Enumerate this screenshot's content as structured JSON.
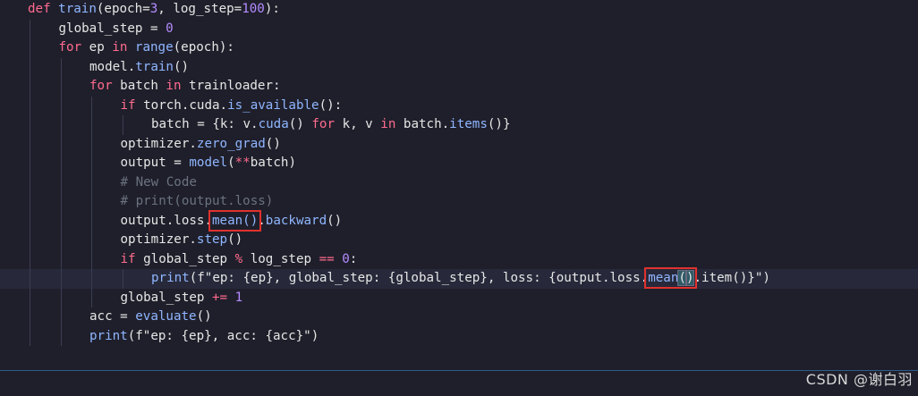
{
  "editor": {
    "lines": [
      [
        {
          "t": "def ",
          "c": "kw"
        },
        {
          "t": "train",
          "c": "fn"
        },
        {
          "t": "(epoch=",
          "c": "tx"
        },
        {
          "t": "3",
          "c": "num"
        },
        {
          "t": ", log_step=",
          "c": "tx"
        },
        {
          "t": "100",
          "c": "num"
        },
        {
          "t": "):",
          "c": "tx"
        }
      ],
      [
        {
          "t": "global_step = ",
          "c": "tx"
        },
        {
          "t": "0",
          "c": "num"
        }
      ],
      [
        {
          "t": "for ",
          "c": "kw"
        },
        {
          "t": "ep ",
          "c": "tx"
        },
        {
          "t": "in ",
          "c": "kw"
        },
        {
          "t": "range",
          "c": "fn"
        },
        {
          "t": "(epoch):",
          "c": "tx"
        }
      ],
      [
        {
          "t": "model.",
          "c": "tx"
        },
        {
          "t": "train",
          "c": "fn"
        },
        {
          "t": "()",
          "c": "tx"
        }
      ],
      [
        {
          "t": "for ",
          "c": "kw"
        },
        {
          "t": "batch ",
          "c": "tx"
        },
        {
          "t": "in ",
          "c": "kw"
        },
        {
          "t": "trainloader:",
          "c": "tx"
        }
      ],
      [
        {
          "t": "if ",
          "c": "kw"
        },
        {
          "t": "torch.cuda.",
          "c": "tx"
        },
        {
          "t": "is_available",
          "c": "fn"
        },
        {
          "t": "():",
          "c": "tx"
        }
      ],
      [
        {
          "t": "batch = {k: v.",
          "c": "tx"
        },
        {
          "t": "cuda",
          "c": "fn"
        },
        {
          "t": "() ",
          "c": "tx"
        },
        {
          "t": "for ",
          "c": "kw"
        },
        {
          "t": "k, v ",
          "c": "tx"
        },
        {
          "t": "in ",
          "c": "kw"
        },
        {
          "t": "batch.",
          "c": "tx"
        },
        {
          "t": "items",
          "c": "fn"
        },
        {
          "t": "()}",
          "c": "tx"
        }
      ],
      [
        {
          "t": "optimizer.",
          "c": "tx"
        },
        {
          "t": "zero_grad",
          "c": "fn"
        },
        {
          "t": "()",
          "c": "tx"
        }
      ],
      [
        {
          "t": "output = ",
          "c": "tx"
        },
        {
          "t": "model",
          "c": "fn"
        },
        {
          "t": "(",
          "c": "tx"
        },
        {
          "t": "**",
          "c": "op"
        },
        {
          "t": "batch)",
          "c": "tx"
        }
      ],
      [
        {
          "t": "# New Code",
          "c": "cm"
        }
      ],
      [
        {
          "t": "# print(output.loss)",
          "c": "cm"
        }
      ],
      [
        {
          "t": "output.loss.",
          "c": "tx"
        },
        {
          "t": "mean()",
          "c": "fn",
          "hl": true
        },
        {
          "t": ".",
          "c": "tx"
        },
        {
          "t": "backward",
          "c": "fn"
        },
        {
          "t": "()",
          "c": "tx"
        }
      ],
      [
        {
          "t": "optimizer.",
          "c": "tx"
        },
        {
          "t": "step",
          "c": "fn"
        },
        {
          "t": "()",
          "c": "tx"
        }
      ],
      [
        {
          "t": "if ",
          "c": "kw"
        },
        {
          "t": "global_step ",
          "c": "tx"
        },
        {
          "t": "% ",
          "c": "op"
        },
        {
          "t": "log_step ",
          "c": "tx"
        },
        {
          "t": "== ",
          "c": "op"
        },
        {
          "t": "0",
          "c": "num"
        },
        {
          "t": ":",
          "c": "tx"
        }
      ],
      [
        {
          "t": "print",
          "c": "fn"
        },
        {
          "t": "(f\"ep: {ep}, global_step: {global_step}, loss: {output.loss.",
          "c": "tx"
        },
        {
          "t": "mean()",
          "c": "fn",
          "hl": true,
          "active": true
        },
        {
          "t": ".item()}\")",
          "c": "tx"
        }
      ],
      [
        {
          "t": "global_step ",
          "c": "tx"
        },
        {
          "t": "+= ",
          "c": "op"
        },
        {
          "t": "1",
          "c": "num"
        }
      ],
      [
        {
          "t": "acc = ",
          "c": "tx"
        },
        {
          "t": "evaluate",
          "c": "fn"
        },
        {
          "t": "()",
          "c": "tx"
        }
      ],
      [
        {
          "t": "print",
          "c": "fn"
        },
        {
          "t": "(f\"ep: {ep}, acc: {acc}\")",
          "c": "tx"
        }
      ]
    ],
    "indent_levels": [
      0,
      1,
      1,
      2,
      2,
      3,
      4,
      3,
      3,
      3,
      3,
      3,
      3,
      3,
      4,
      3,
      2,
      2
    ],
    "current_line": 14
  },
  "watermark": "CSDN @谢白羽"
}
